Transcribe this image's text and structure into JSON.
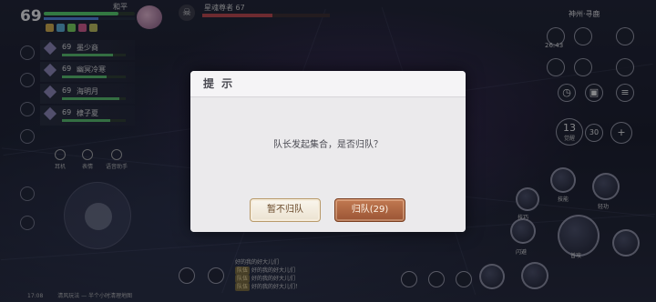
{
  "player": {
    "level": "69",
    "name": "和平",
    "hp_ratio": 0.82,
    "mp_ratio": 0.6
  },
  "target": {
    "name": "星魂尊者 67",
    "hp_ratio": 0.55
  },
  "party": [
    {
      "level": "69",
      "name": "墨少商",
      "hp_ratio": 0.8
    },
    {
      "level": "69",
      "name": "幽冥冷寒",
      "hp_ratio": 0.7
    },
    {
      "level": "69",
      "name": "海明月",
      "hp_ratio": 0.9
    },
    {
      "level": "69",
      "name": "棣子夏",
      "hp_ratio": 0.75
    }
  ],
  "toolbar": {
    "items": [
      "耳机",
      "表情",
      "语音助手"
    ]
  },
  "right_hud": {
    "server": "神州·寻鹿",
    "time": "26:43",
    "buttons": [
      "人",
      "包",
      "活"
    ],
    "skill_counter": "13",
    "skill_counter_label": "觉醒",
    "small_counter": "30",
    "skill_labels": [
      "普攻",
      "闪避",
      "技能",
      "轻功",
      "技巧"
    ]
  },
  "chat": {
    "lines": [
      {
        "tag": "",
        "text": "好的我的好大儿们"
      },
      {
        "tag": "队伍",
        "text": "好的我的好大儿们"
      },
      {
        "tag": "队伍",
        "text": "好的我的好大儿们"
      },
      {
        "tag": "队伍",
        "text": "好的我的好大儿们！"
      }
    ]
  },
  "status_bar": {
    "time": "17:08",
    "hint": "清风玩法 — 半个小时清理地图"
  },
  "dialog": {
    "title": "提 示",
    "message": "队长发起集合，是否归队？",
    "decline_label": "暂不归队",
    "accept_label": "归队(29)"
  },
  "colors": {
    "accent": "#9a5434",
    "dialog_bg": "#ebeaec",
    "hp": "#58c06a",
    "mp": "#4f86e0"
  }
}
